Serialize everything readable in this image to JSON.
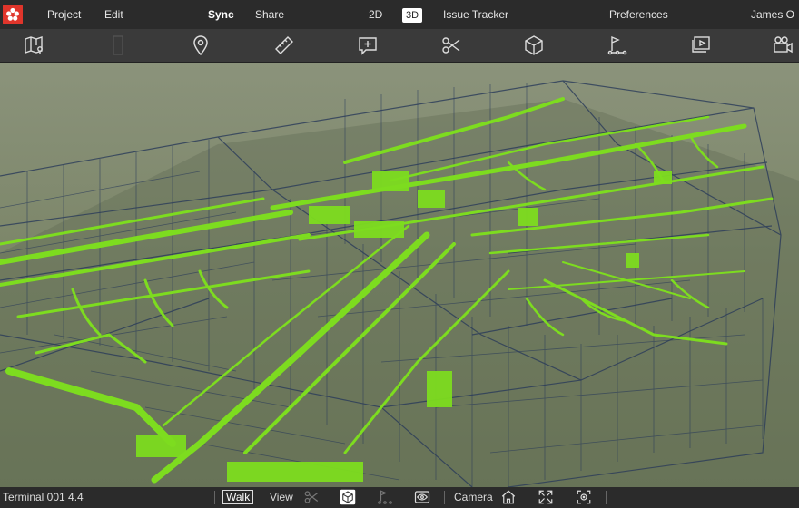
{
  "app": {
    "menu": {
      "project": "Project",
      "edit": "Edit",
      "sync": "Sync",
      "share": "Share",
      "mode_2d": "2D",
      "mode_3d": "3D",
      "issue_tracker": "Issue Tracker",
      "preferences": "Preferences",
      "user": "James O"
    }
  },
  "toolbar": {
    "icons": [
      "map-icon",
      "sheet-icon",
      "location-pin-icon",
      "ruler-icon",
      "add-comment-icon",
      "scissors-icon",
      "cube-icon",
      "path-flag-icon",
      "slideshow-icon",
      "video-camera-icon"
    ]
  },
  "bottombar": {
    "model_name": "Terminal 001 4.4",
    "walk": "Walk",
    "view": "View",
    "camera": "Camera"
  },
  "colors": {
    "accent": "#e0352b",
    "model_green": "#7ddc1f",
    "frame_blue": "#2a3b5a"
  }
}
